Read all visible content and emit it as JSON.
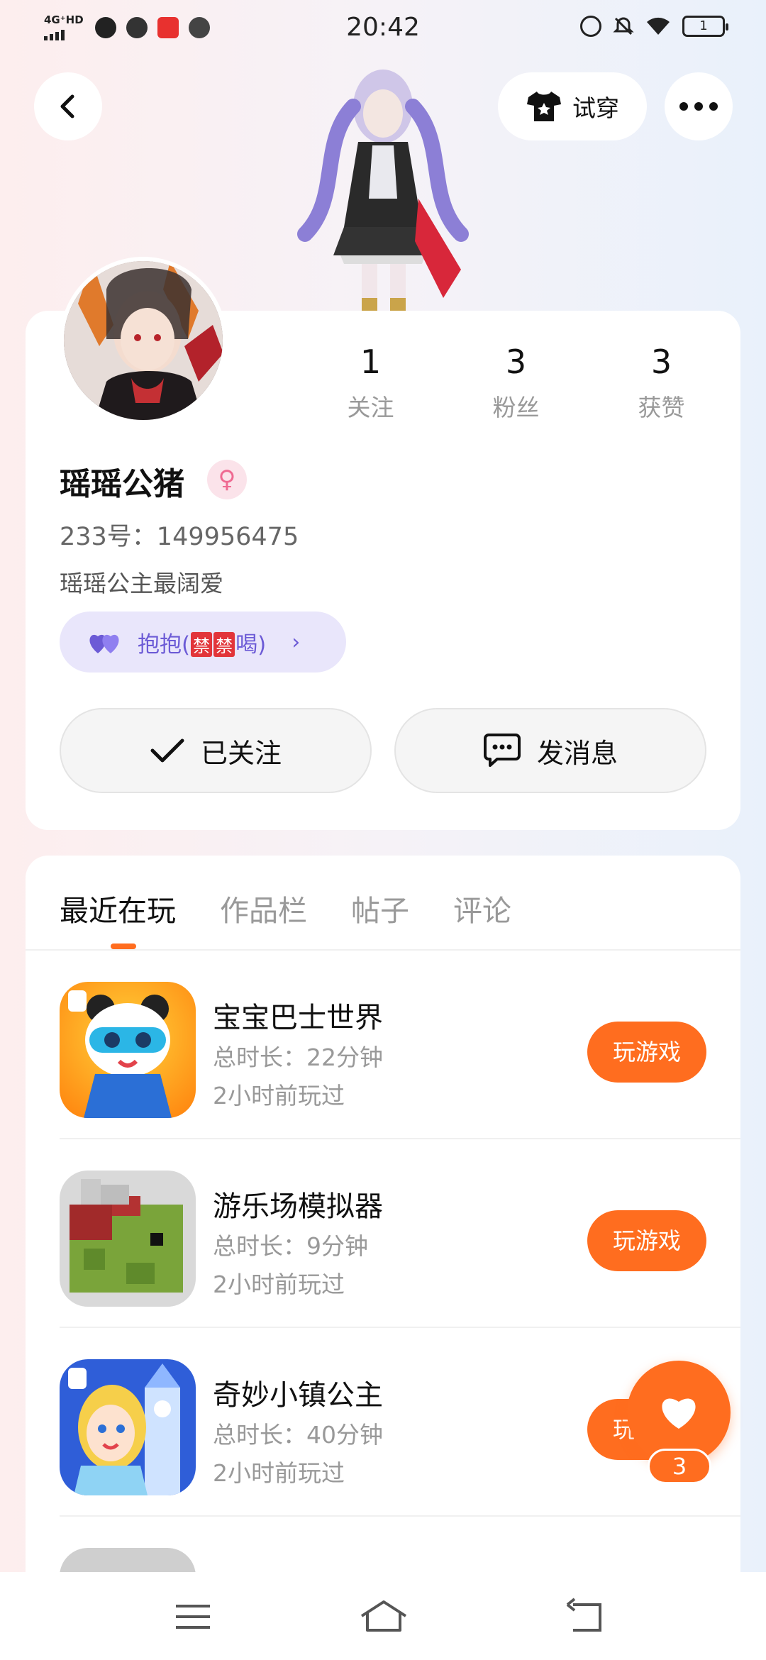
{
  "status_bar": {
    "network": "4G⁺HD",
    "time": "20:42",
    "battery": "1"
  },
  "header": {
    "tryon_label": "试穿"
  },
  "profile": {
    "stats": [
      {
        "value": "1",
        "label": "关注"
      },
      {
        "value": "3",
        "label": "粉丝"
      },
      {
        "value": "3",
        "label": "获赞"
      }
    ],
    "username": "瑶瑶公猪",
    "gender_symbol": "♀",
    "uid": "233号：149956475",
    "bio": "瑶瑶公主最阔爱",
    "hug_tag": {
      "prefix": "抱抱(",
      "stamps": [
        "禁",
        "禁"
      ],
      "suffix": "喝)",
      "arrow": "›"
    },
    "follow_label": "已关注",
    "message_label": "发消息"
  },
  "tabs": [
    "最近在玩",
    "作品栏",
    "帖子",
    "评论"
  ],
  "games": [
    {
      "name": "宝宝巴士世界",
      "duration": "总时长：22分钟",
      "last_played": "2小时前玩过",
      "button": "玩游戏"
    },
    {
      "name": "游乐场模拟器",
      "duration": "总时长：9分钟",
      "last_played": "2小时前玩过",
      "button": "玩游戏"
    },
    {
      "name": "奇妙小镇公主",
      "duration": "总时长：40分钟",
      "last_played": "2小时前玩过",
      "button": "玩游戏"
    }
  ],
  "like_fab": {
    "count": "3"
  },
  "colors": {
    "accent": "#ff6d1f",
    "tag_bg": "#e9e6fb",
    "tag_text": "#6c5bd6"
  },
  "icons": [
    "back-icon",
    "tshirt-icon",
    "more-icon",
    "check-icon",
    "chat-icon",
    "heart-icon",
    "menu-icon",
    "home-icon",
    "return-icon"
  ]
}
